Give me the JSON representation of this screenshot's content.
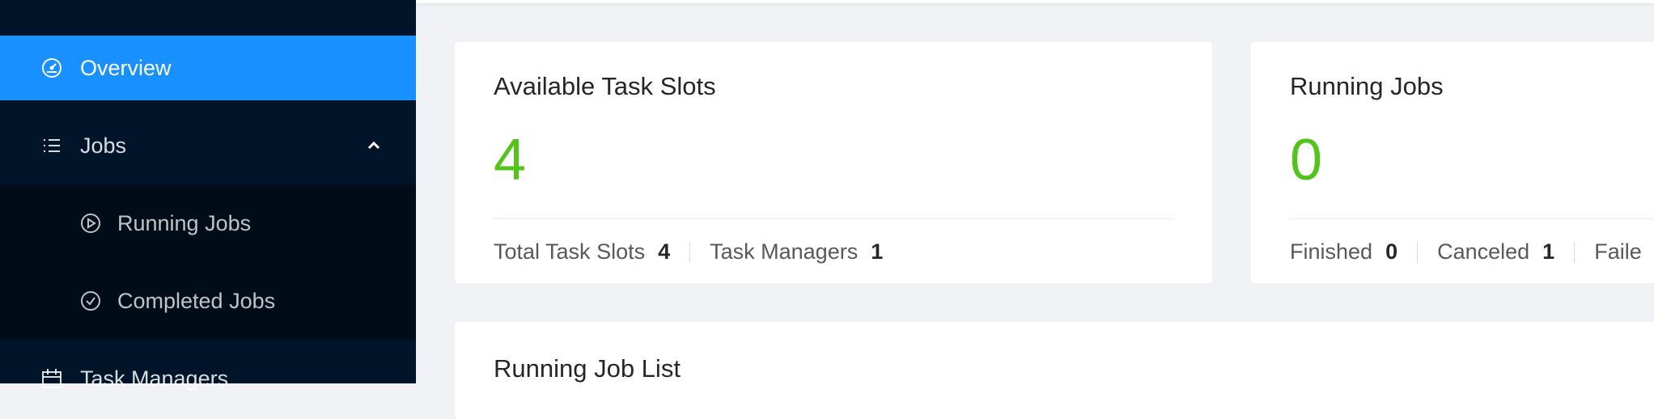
{
  "sidebar": {
    "items": [
      {
        "label": "Overview",
        "icon": "dashboard-icon",
        "active": true
      },
      {
        "label": "Jobs",
        "icon": "list-icon",
        "expanded": true
      },
      {
        "label": "Task Managers",
        "icon": "calendar-icon"
      }
    ],
    "jobs_submenu": [
      {
        "label": "Running Jobs",
        "icon": "play-circle-icon"
      },
      {
        "label": "Completed Jobs",
        "icon": "check-circle-icon"
      }
    ]
  },
  "cards": {
    "task_slots": {
      "title": "Available Task Slots",
      "value": "4",
      "stats": [
        {
          "label": "Total Task Slots",
          "value": "4"
        },
        {
          "label": "Task Managers",
          "value": "1"
        }
      ]
    },
    "running_jobs": {
      "title": "Running Jobs",
      "value": "0",
      "stats": [
        {
          "label": "Finished",
          "value": "0"
        },
        {
          "label": "Canceled",
          "value": "1"
        },
        {
          "label": "Faile",
          "value": ""
        }
      ]
    },
    "running_job_list": {
      "title": "Running Job List"
    }
  },
  "colors": {
    "sidebar_bg": "#001529",
    "submenu_bg": "#000c17",
    "active_bg": "#1890ff",
    "value_green": "#52c41a",
    "page_bg": "#f0f2f5"
  }
}
